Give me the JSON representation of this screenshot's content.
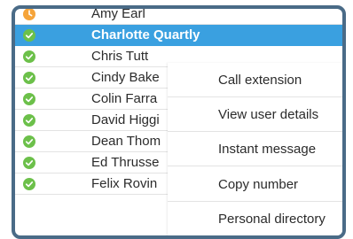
{
  "contacts": [
    {
      "name": "Amy Earl",
      "status": "away",
      "selected": false
    },
    {
      "name": "Charlotte Quartly",
      "status": "available",
      "selected": true
    },
    {
      "name": "Chris Tutt",
      "status": "available",
      "selected": false
    },
    {
      "name": "Cindy Bake",
      "status": "available",
      "selected": false
    },
    {
      "name": "Colin Farra",
      "status": "available",
      "selected": false
    },
    {
      "name": "David Higgi",
      "status": "available",
      "selected": false
    },
    {
      "name": "Dean Thom",
      "status": "available",
      "selected": false
    },
    {
      "name": "Ed Thrusse",
      "status": "available",
      "selected": false
    },
    {
      "name": "Felix Rovin",
      "status": "available",
      "selected": false
    }
  ],
  "context_menu": {
    "items": [
      "Call extension",
      "View user details",
      "Instant message",
      "Copy number",
      "Personal directory"
    ]
  },
  "colors": {
    "frame": "#4a6b87",
    "selected_row": "#3aa0e0",
    "status_available": "#6cc04a",
    "status_away": "#f5a43a"
  },
  "icons": {
    "available": "check-circle-icon",
    "away": "clock-icon"
  }
}
